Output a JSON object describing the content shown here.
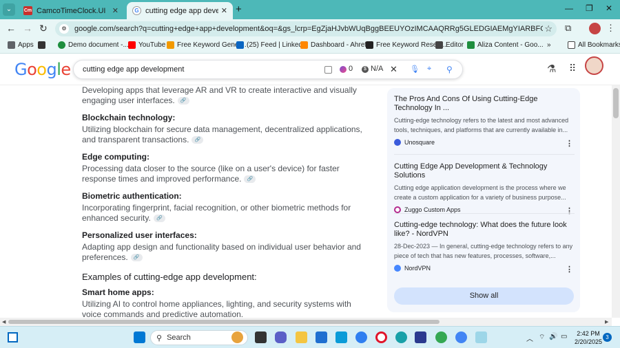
{
  "browser": {
    "tabs": [
      {
        "title": "CamcoTimeClock.UI",
        "favicon": "Cm"
      },
      {
        "title": "cutting edge app development",
        "favicon": "G"
      }
    ],
    "new_tab": "+",
    "address": "google.com/search?q=cutting+edge+app+development&oq=&gs_lcrp=EgZjaHJvbWUqBggBEEUYOzIMCAAQRRg5GLEDGIAEMgYIARBFGDsyBggCECMYJzIKCAMQA...",
    "bookmarks": [
      "Apps",
      "Demo document -...",
      "YouTube",
      "Free Keyword Gener...",
      "(25) Feed | LinkedIn",
      "Dashboard - Ahrefs",
      "Free Keyword Resea...",
      "Editor",
      "Aliza Content - Goo...",
      "All Bookmarks"
    ]
  },
  "google": {
    "logo": [
      "G",
      "o",
      "o",
      "g",
      "l",
      "e"
    ],
    "query": "cutting edge app development",
    "ext_count": "0",
    "ext_value": "N/A"
  },
  "results": {
    "intro_text": "Developing apps that leverage AR and VR to create interactive and visually engaging user interfaces.",
    "items": [
      {
        "title": "Blockchain technology:",
        "text": "Utilizing blockchain for secure data management, decentralized applications, and transparent transactions."
      },
      {
        "title": "Edge computing:",
        "text": "Processing data closer to the source (like on a user's device) for faster response times and improved performance."
      },
      {
        "title": "Biometric authentication:",
        "text": "Incorporating fingerprint, facial recognition, or other biometric methods for enhanced security."
      },
      {
        "title": "Personalized user interfaces:",
        "text": "Adapting app design and functionality based on individual user behavior and preferences."
      }
    ],
    "examples_heading": "Examples of cutting-edge app development:",
    "example": {
      "title": "Smart home apps:",
      "text": "Utilizing AI to control home appliances, lighting, and security systems with voice commands and predictive automation."
    }
  },
  "side_panel": {
    "cards": [
      {
        "title": "The Pros And Cons Of Using Cutting-Edge Technology In ...",
        "snippet": "Cutting-edge technology refers to the latest and most advanced tools, techniques, and platforms that are currently available in...",
        "source": "Unosquare"
      },
      {
        "title": "Cutting Edge App Development & Technology Solutions",
        "snippet": "Cutting edge application development is the process where we create a custom application for a variety of business purpose...",
        "source": "Zuggo Custom Apps"
      },
      {
        "title": "Cutting-edge technology: What does the future look like? - NordVPN",
        "snippet": "28-Dec-2023 — In general, cutting-edge technology refers to any piece of tech that has new features, processes, software,...",
        "source": "NordVPN"
      }
    ],
    "show_all": "Show all"
  },
  "taskbar": {
    "search_label": "Search",
    "time": "2:42 PM",
    "date": "2/20/2025",
    "notifications": "3"
  }
}
